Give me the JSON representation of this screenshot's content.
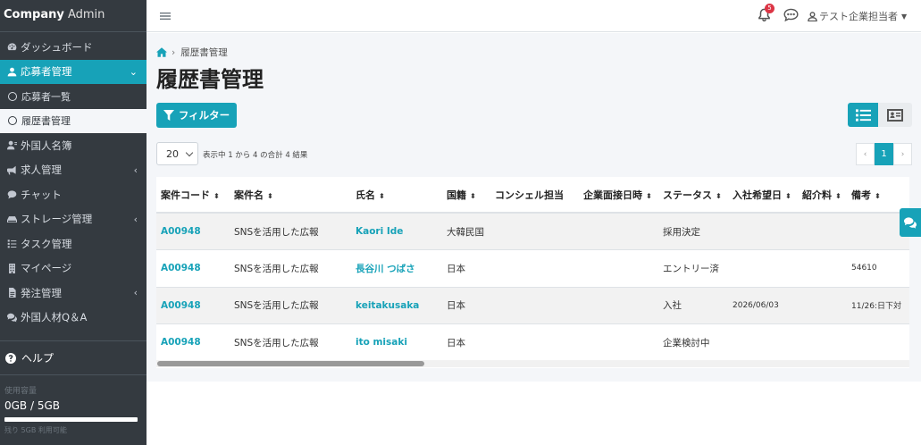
{
  "brand": {
    "bold": "Company",
    "light": "Admin"
  },
  "sidebar": {
    "items": [
      {
        "label": "ダッシュボード"
      },
      {
        "label": "応募者管理"
      },
      {
        "label": "応募者一覧"
      },
      {
        "label": "履歴書管理"
      },
      {
        "label": "外国人名簿"
      },
      {
        "label": "求人管理"
      },
      {
        "label": "チャット"
      },
      {
        "label": "ストレージ管理"
      },
      {
        "label": "タスク管理"
      },
      {
        "label": "マイページ"
      },
      {
        "label": "発注管理"
      },
      {
        "label": "外国人材Q＆A"
      }
    ],
    "help": "ヘルプ",
    "storage": {
      "label": "使用容量",
      "value": "0GB / 5GB",
      "remaining": "残り 5GB 利用可能",
      "used_fraction": 0
    }
  },
  "topbar": {
    "notification_count": "5",
    "user_name": "テスト企業担当者"
  },
  "breadcrumb": {
    "current": "履歴書管理"
  },
  "page_title": "履歴書管理",
  "filter_label": "フィルター",
  "page_size": "20",
  "info_text": "表示中 1 から 4 の合計 4 結果",
  "pager": {
    "prev": "‹",
    "current": "1",
    "next": "›"
  },
  "table": {
    "headers": [
      "案件コード",
      "案件名",
      "氏名",
      "国籍",
      "コンシェル担当",
      "企業面接日時",
      "ステータス",
      "入社希望日",
      "紹介料",
      "備考"
    ],
    "rows": [
      [
        "A00948",
        "SNSを活用した広報",
        "Kaori Ide",
        "大韓民国",
        "",
        "",
        "採用決定",
        "",
        "",
        ""
      ],
      [
        "A00948",
        "SNSを活用した広報",
        "長谷川 つばさ",
        "日本",
        "",
        "",
        "エントリー済",
        "",
        "",
        "54610"
      ],
      [
        "A00948",
        "SNSを活用した広報",
        "keitakusaka",
        "日本",
        "",
        "",
        "入社",
        "2026/06/03",
        "",
        "11/26:日下対"
      ],
      [
        "A00948",
        "SNSを活用した広報",
        "ito misaki",
        "日本",
        "",
        "",
        "企業検討中",
        "",
        "",
        ""
      ]
    ]
  },
  "icons": {
    "dashboard": "tachometer-icon",
    "applicants": "user-icon",
    "list": "circle-icon",
    "foreigners": "user-tie-icon",
    "jobs": "bullhorn-icon",
    "chat": "comment-icon",
    "storage": "hdd-icon",
    "tasks": "tasks-icon",
    "mypage": "building-icon",
    "orders": "file-icon",
    "qa": "comments-icon",
    "help": "question-circle-icon"
  },
  "colors": {
    "accent": "#17a2b8",
    "sidebar": "#343a40",
    "badge": "#dc3545"
  }
}
